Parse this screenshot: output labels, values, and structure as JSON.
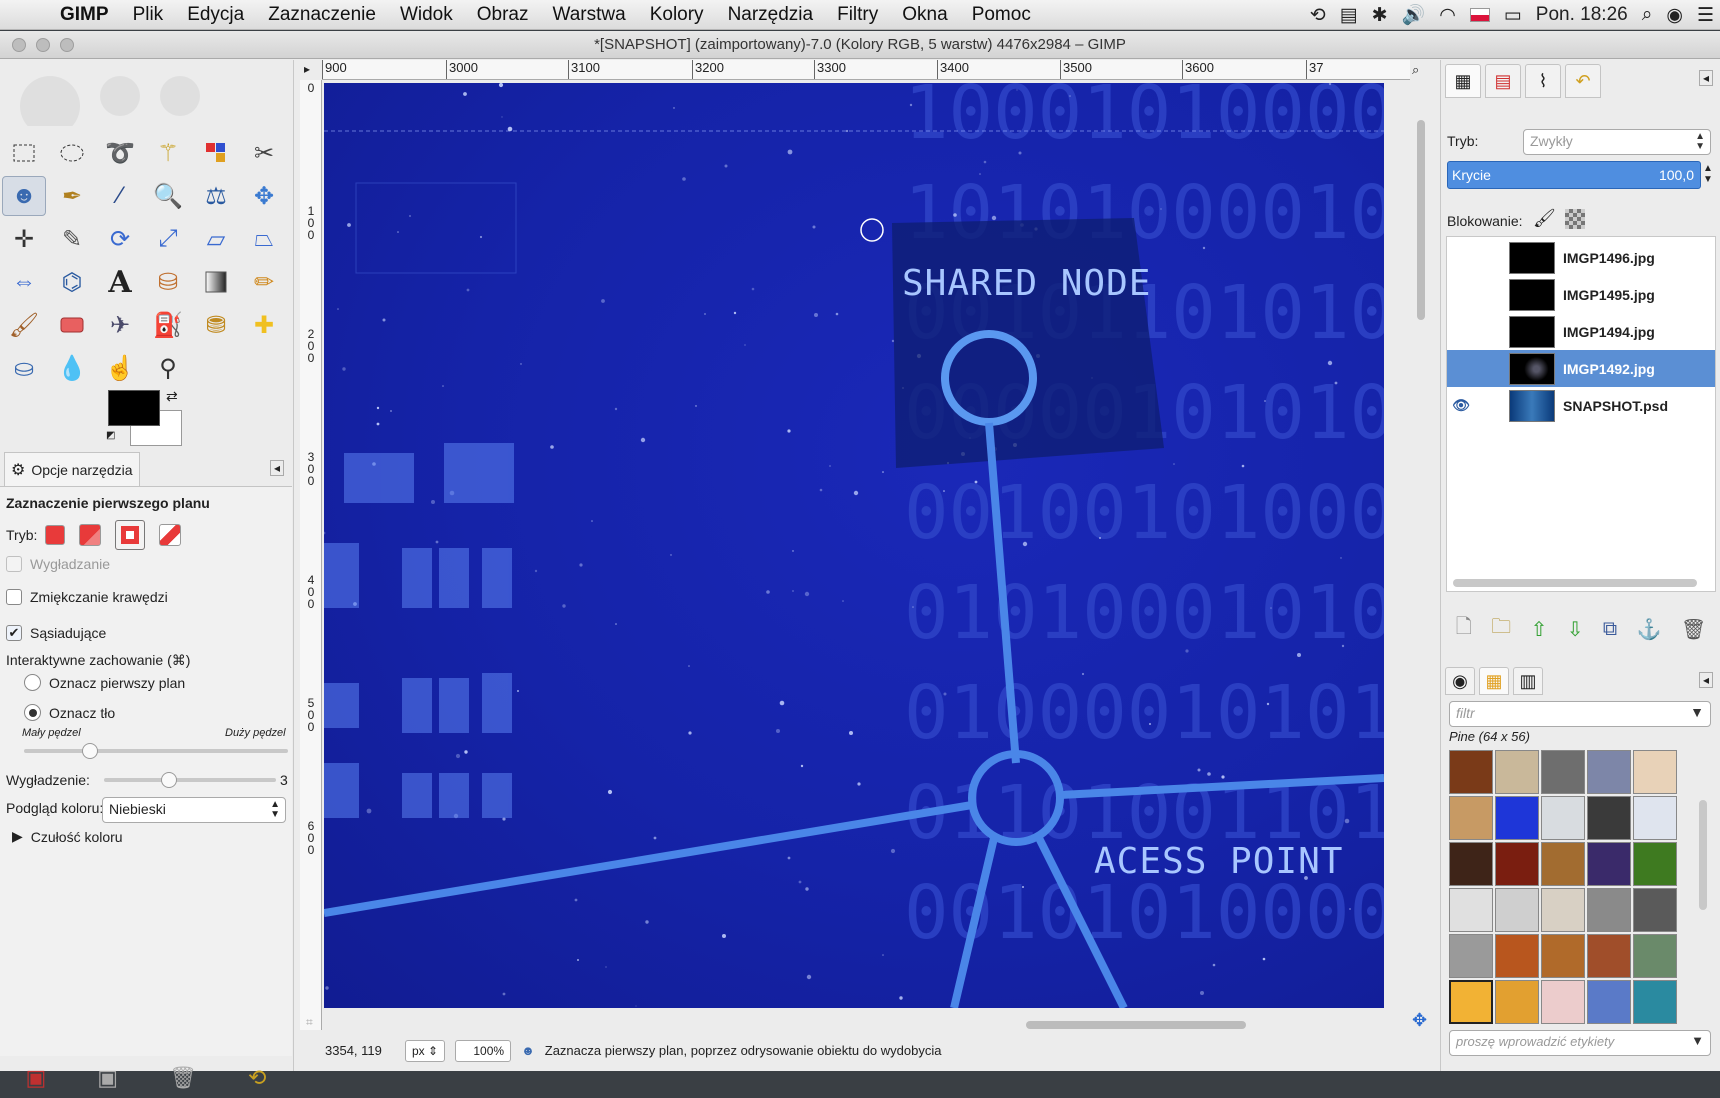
{
  "menubar": {
    "app_name": "GIMP",
    "items": [
      "Plik",
      "Edycja",
      "Zaznaczenie",
      "Widok",
      "Obraz",
      "Warstwa",
      "Kolory",
      "Narzędzia",
      "Filtry",
      "Okna",
      "Pomoc"
    ],
    "clock": "Pon. 18:26"
  },
  "window": {
    "title": "*[SNAPSHOT] (zaimportowany)-7.0 (Kolory RGB, 5 warstw) 4476x2984 – GIMP"
  },
  "toolbox": {
    "tools": [
      "rect-select",
      "ellipse-select",
      "free-select",
      "fuzzy-select",
      "select-by-color",
      "scissors-select",
      "foreground-select",
      "paths",
      "color-picker",
      "zoom",
      "measure",
      "move",
      "align",
      "crop",
      "rotate",
      "scale",
      "shear",
      "perspective",
      "flip",
      "cage-transform",
      "text",
      "bucket-fill",
      "blend",
      "pencil",
      "paintbrush",
      "eraser",
      "airbrush",
      "ink",
      "clone",
      "heal",
      "perspective-clone",
      "blur",
      "smudge",
      "dodge-burn"
    ],
    "active_tool_index": 6
  },
  "tool_options": {
    "tab_label": "Opcje narzędzia",
    "heading": "Zaznaczenie pierwszego planu",
    "mode_label": "Tryb:",
    "antialias_label": "Wygładzanie",
    "feather_label": "Zmiękczanie krawędzi",
    "contiguous_label": "Sąsiadujące",
    "interactive_label": "Interaktywne zachowanie  (⌘)",
    "radio_foreground": "Oznacz pierwszy plan",
    "radio_background": "Oznacz tło",
    "small_brush": "Mały pędzel",
    "large_brush": "Duży pędzel",
    "brush_size_level": 0.25,
    "smoothing_label": "Wygładzenie:",
    "smoothing_value": "3",
    "smoothing_level": 0.38,
    "preview_label": "Podgląd koloru:",
    "preview_value": "Niebieski",
    "sensitivity_label": "Czułość koloru"
  },
  "canvas": {
    "ruler_h": [
      "900",
      "3000",
      "3100",
      "3200",
      "3300",
      "3400",
      "3500",
      "3600",
      "37"
    ],
    "ruler_v": [
      "0",
      "100",
      "200",
      "300",
      "400",
      "500",
      "600"
    ],
    "text_shared_node": "SHARED NODE",
    "text_access_point": "ACESS POINT",
    "binary_rows": [
      "10001010000",
      "10101000010",
      "00101101010",
      "00000101010",
      "00100101000",
      "01010001010",
      "01000010101",
      "01101001101",
      "00101010000"
    ]
  },
  "statusbar": {
    "coords": "3354, 119",
    "unit": "px",
    "zoom": "100%",
    "message": "Zaznacza pierwszy plan, poprzez odrysowanie obiektu do wydobycia"
  },
  "layers": {
    "mode_label": "Tryb:",
    "mode_value": "Zwykły",
    "opacity_label": "Krycie",
    "opacity_value": "100,0",
    "lock_label": "Blokowanie:",
    "list": [
      {
        "name": "IMGP1496.jpg"
      },
      {
        "name": "IMGP1495.jpg"
      },
      {
        "name": "IMGP1494.jpg"
      },
      {
        "name": "IMGP1492.jpg"
      },
      {
        "name": "SNAPSHOT.psd"
      }
    ]
  },
  "patterns": {
    "filter_placeholder": "filtr",
    "current": "Pine (64 x 56)",
    "tags_placeholder": "proszę wprowadzić etykiety",
    "swatches": [
      "#7a3a18",
      "#c9b89a",
      "#6e6e6e",
      "#7d86a8",
      "#e8d2b8",
      "#c79a64",
      "#1e36d8",
      "#d8dce0",
      "#3a3a3a",
      "#dfe4ee",
      "#3e2418",
      "#7a1e10",
      "#a26c30",
      "#3a2a6a",
      "#3e7a20",
      "#e0e0e0",
      "#cfcfcf",
      "#d8d0c4",
      "#8a8a8a",
      "#5a5a5a",
      "#9a9a9a",
      "#b8561e",
      "#b06a2a",
      "#a04e2a",
      "#6a8a6a",
      "#f2b234",
      "#e2a030",
      "#eccccc",
      "#5a7ac8",
      "#2a8aa0"
    ]
  }
}
